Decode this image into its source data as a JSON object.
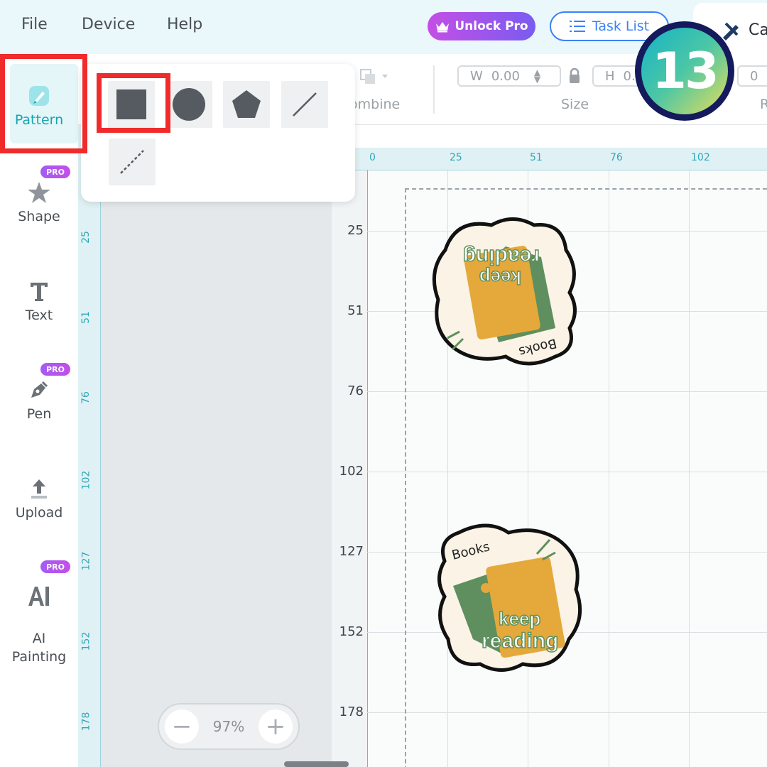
{
  "menu": {
    "file": "File",
    "device": "Device",
    "help": "Help"
  },
  "header": {
    "unlock_pro": "Unlock Pro",
    "task_list": "Task List",
    "cut_tab": "Ca"
  },
  "step_badge": "13",
  "sidebar": {
    "items": [
      {
        "label": "Pattern",
        "icon": "pattern-icon",
        "pro": false,
        "active": true
      },
      {
        "label": "Shape",
        "icon": "star-shape-icon",
        "pro": true
      },
      {
        "label": "Text",
        "icon": "text-t-icon",
        "pro": false
      },
      {
        "label": "Pen",
        "icon": "pen-icon",
        "pro": true
      },
      {
        "label": "Upload",
        "icon": "upload-icon",
        "pro": false
      },
      {
        "label": "AI\nPainting",
        "icon": "ai-icon",
        "pro": true
      }
    ],
    "pro_label": "PRO"
  },
  "toolbar": {
    "combine": "ombine",
    "size_label": "Size",
    "width_label": "W",
    "width_value": "0.00",
    "height_label": "H",
    "height_value": "0.",
    "third_value": "0",
    "r_label": "R"
  },
  "popup": {
    "shapes": [
      "square-shape",
      "circle-shape",
      "pentagon-shape",
      "line-shape",
      "dashed-line-shape"
    ],
    "selected": "square-shape"
  },
  "ruler_top": [
    "0",
    "25",
    "51",
    "76",
    "102"
  ],
  "ruler_left": [
    "25",
    "51",
    "76",
    "102",
    "127",
    "152",
    "178"
  ],
  "canvas_y_labels": [
    "25",
    "51",
    "76",
    "102",
    "127",
    "152",
    "178"
  ],
  "zoom": {
    "value": "97%",
    "minus": "−",
    "plus": "+"
  },
  "stickers": [
    {
      "line1": "keep",
      "line2": "reading",
      "tag": "Books",
      "flipped": true
    },
    {
      "line1": "keep",
      "line2": "reading",
      "tag": "Books",
      "flipped": false
    }
  ],
  "colors": {
    "accent": "#2fa7b7",
    "highlight": "#f02b2b",
    "pro_purple": "#a45cf2",
    "task_blue": "#3b82f6"
  }
}
